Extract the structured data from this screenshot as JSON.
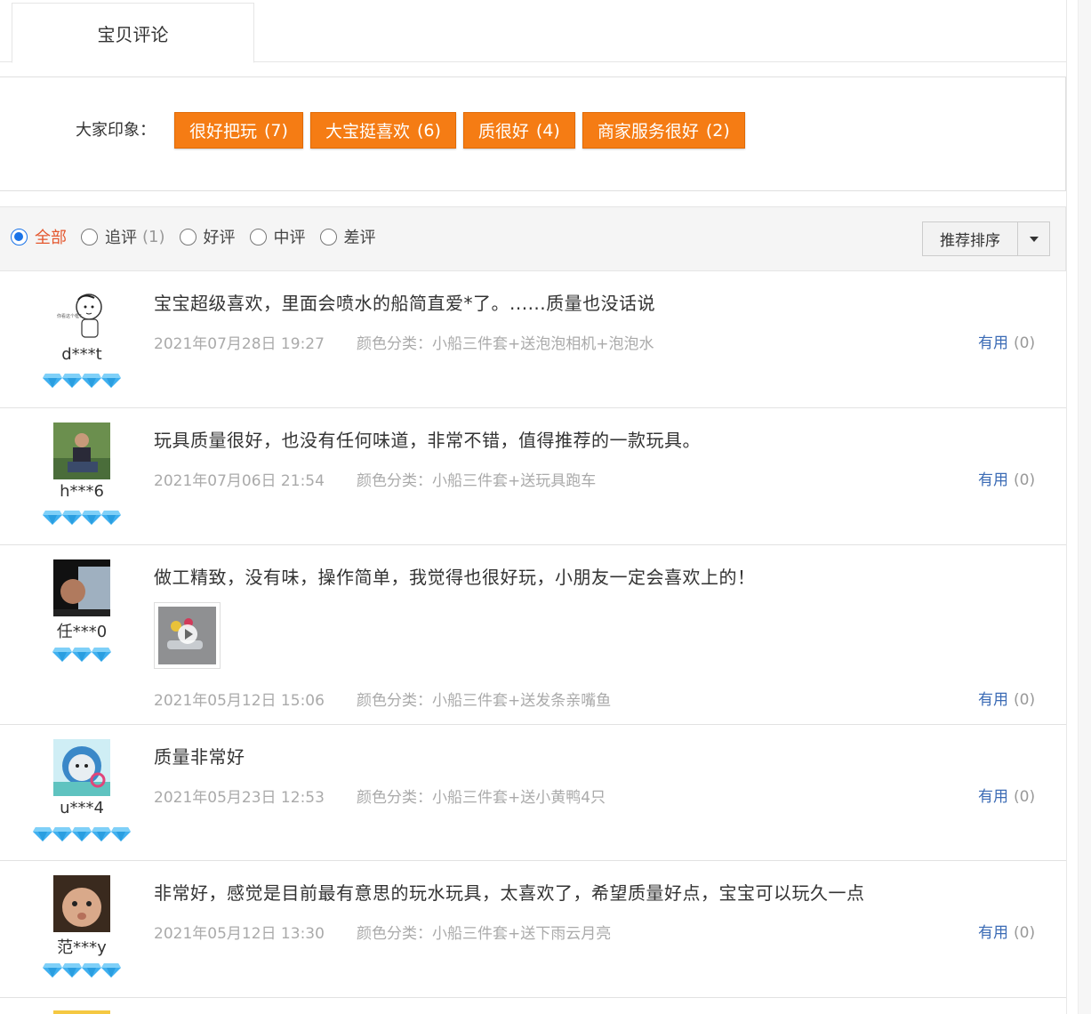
{
  "tab": {
    "label": "宝贝评论"
  },
  "impression": {
    "label": "大家印象：",
    "tags": [
      {
        "text": "很好把玩",
        "count": "(7)"
      },
      {
        "text": "大宝挺喜欢",
        "count": "(6)"
      },
      {
        "text": "质很好",
        "count": "(4)"
      },
      {
        "text": "商家服务很好",
        "count": "(2)"
      }
    ]
  },
  "filters": {
    "options": [
      {
        "label": "全部",
        "num": "",
        "checked": true
      },
      {
        "label": "追评",
        "num": "(1)",
        "checked": false
      },
      {
        "label": "好评",
        "num": "",
        "checked": false
      },
      {
        "label": "中评",
        "num": "",
        "checked": false
      },
      {
        "label": "差评",
        "num": "",
        "checked": false
      }
    ],
    "sort_label": "推荐排序"
  },
  "reviews": [
    {
      "user": "d***t",
      "gems": 4,
      "text": "宝宝超级喜欢，里面会喷水的船简直爱*了。......质量也没话说",
      "date": "2021年07月28日 19:27",
      "spec": "颜色分类：小船三件套+送泡泡相机+泡泡水",
      "useful": "有用",
      "useful_count": "(0)"
    },
    {
      "user": "h***6",
      "gems": 4,
      "text": "玩具质量很好，也没有任何味道，非常不错，值得推荐的一款玩具。",
      "date": "2021年07月06日 21:54",
      "spec": "颜色分类：小船三件套+送玩具跑车",
      "useful": "有用",
      "useful_count": "(0)"
    },
    {
      "user": "任***0",
      "gems": 3,
      "text": "做工精致，没有味，操作简单，我觉得也很好玩，小朋友一定会喜欢上的！",
      "date": "2021年05月12日 15:06",
      "spec": "颜色分类：小船三件套+送发条亲嘴鱼",
      "useful": "有用",
      "useful_count": "(0)"
    },
    {
      "user": "u***4",
      "gems": 5,
      "text": "质量非常好",
      "date": "2021年05月23日 12:53",
      "spec": "颜色分类：小船三件套+送小黄鸭4只",
      "useful": "有用",
      "useful_count": "(0)"
    },
    {
      "user": "范***y",
      "gems": 4,
      "text": "非常好，感觉是目前最有意思的玩水玩具，太喜欢了，希望质量好点，宝宝可以玩久一点",
      "date": "2021年05月12日 13:30",
      "spec": "颜色分类：小船三件套+送下雨云月亮",
      "useful": "有用",
      "useful_count": "(0)"
    }
  ],
  "colors": {
    "accent_orange": "#f57c14",
    "link_blue": "#3b6bb5",
    "gem_blue": "#3fb0f0"
  },
  "icons": [
    "diamond-gem-icon",
    "play-icon",
    "dropdown-arrow-icon",
    "radio-icon"
  ]
}
